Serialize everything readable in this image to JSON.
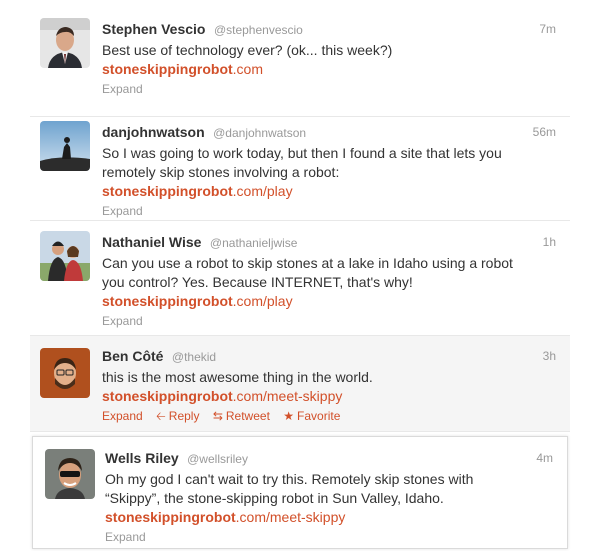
{
  "tweets": [
    {
      "fullname": "Stephen Vescio",
      "username": "@stephenvescio",
      "time": "7m",
      "lines": [
        "Best use of technology ever? (ok... this week?)"
      ],
      "link_domain": "stoneskippingrobot",
      "link_rest": ".com",
      "expand": "Expand"
    },
    {
      "fullname": "danjohnwatson",
      "username": "@danjohnwatson",
      "time": "56m",
      "lines": [
        "So I was going to work today, but then I found a site that lets you",
        "remotely skip stones involving a robot:"
      ],
      "link_domain": "stoneskippingrobot",
      "link_rest": ".com/play",
      "expand": "Expand"
    },
    {
      "fullname": "Nathaniel Wise",
      "username": "@nathanieljwise",
      "time": "1h",
      "lines": [
        "Can you use a robot to skip stones at a lake in Idaho using a robot",
        "you control? Yes. Because INTERNET, that's why!"
      ],
      "link_domain": "stoneskippingrobot",
      "link_rest": ".com/play",
      "expand": "Expand"
    },
    {
      "fullname": "Ben Côté",
      "username": "@thekid",
      "time": "3h",
      "lines": [
        "this is the most awesome thing in the world."
      ],
      "link_domain": "stoneskippingrobot",
      "link_rest": ".com/meet-skippy",
      "expand": "Expand",
      "actions": {
        "reply": "Reply",
        "retweet": "Retweet",
        "favorite": "Favorite"
      }
    },
    {
      "fullname": "Wells Riley",
      "username": "@wellsriley",
      "time": "4m",
      "lines": [
        "Oh my god I can't wait to try this. Remotely skip stones with",
        "“Skippy”, the stone-skipping robot in Sun Valley, Idaho."
      ],
      "link_domain": "stoneskippingrobot",
      "link_rest": ".com/meet-skippy",
      "expand": "Expand"
    }
  ],
  "icons": {
    "reply": "reply-arrow-icon",
    "retweet": "retweet-icon",
    "favorite": "star-icon"
  },
  "colors": {
    "link": "#d2502a",
    "meta": "#999999",
    "text": "#333333",
    "hover_bg": "#f5f5f5"
  }
}
